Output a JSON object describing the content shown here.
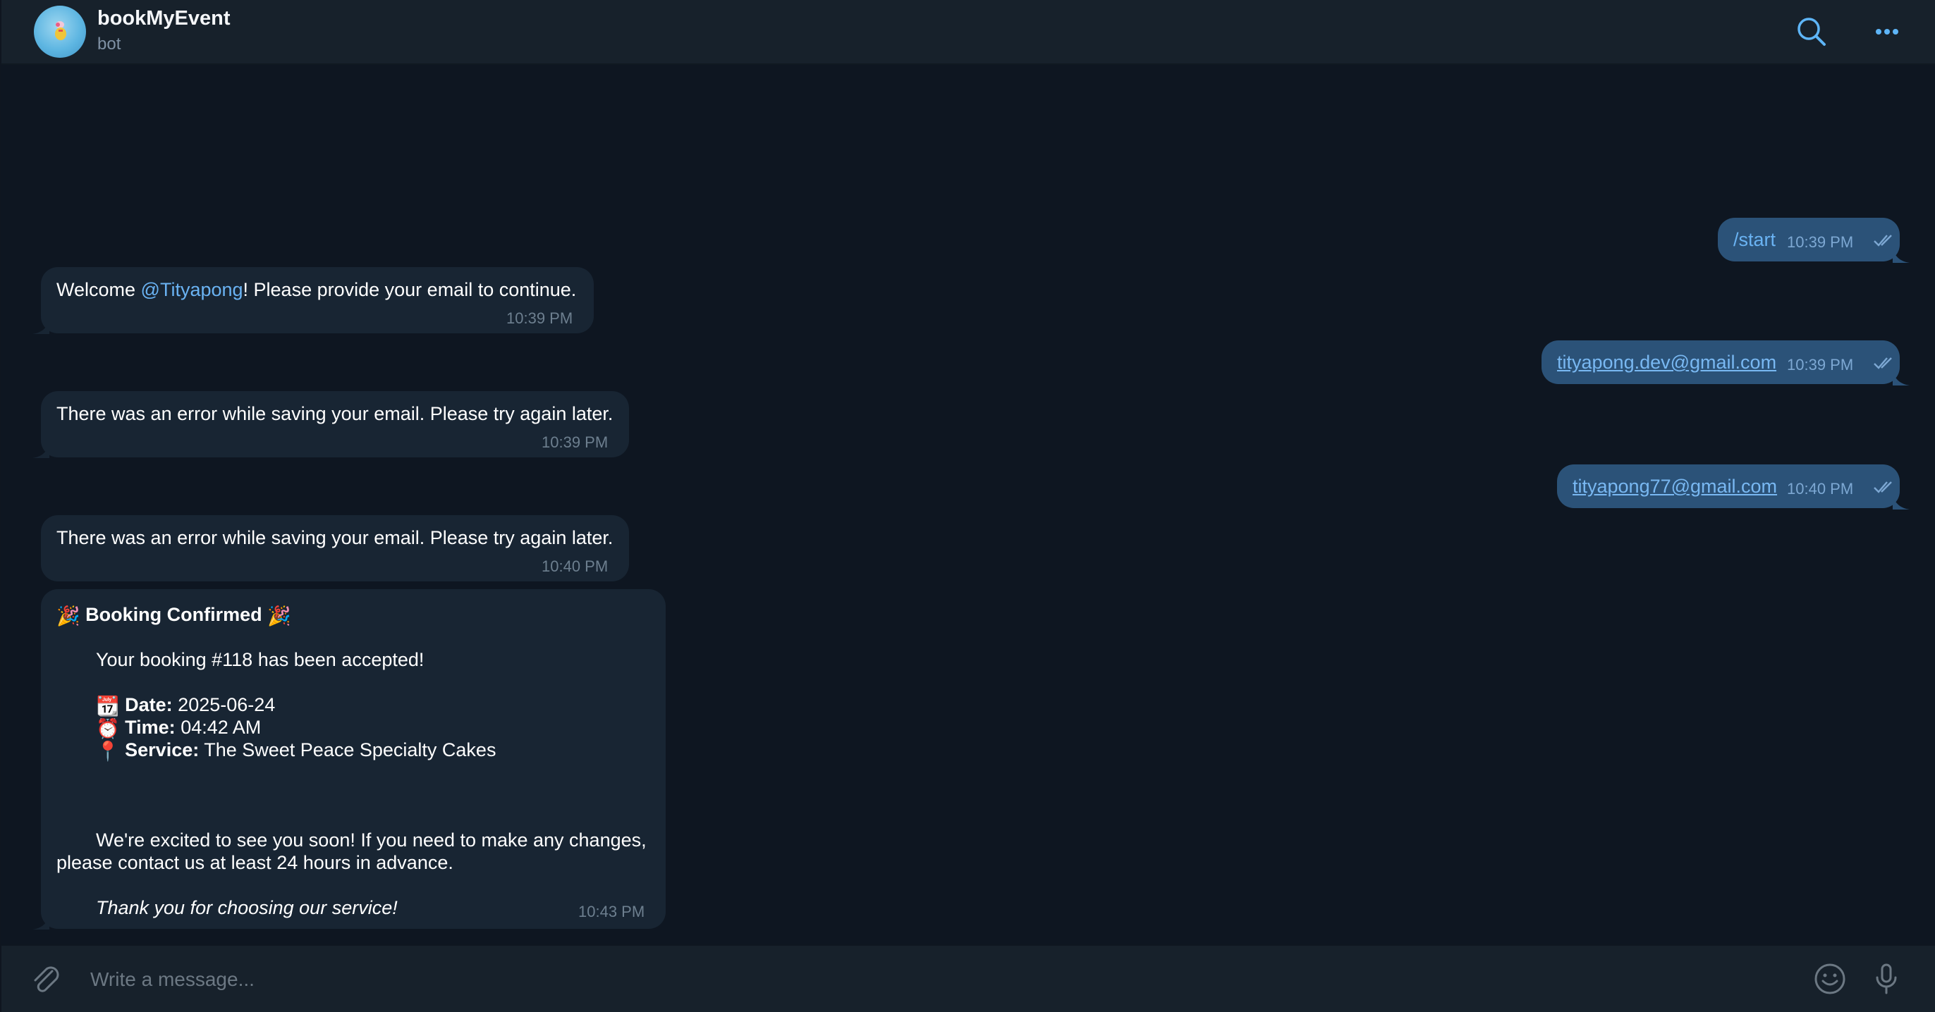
{
  "header": {
    "title": "bookMyEvent",
    "subtitle": "bot",
    "search_icon": "search-icon",
    "more_icon": "more-icon"
  },
  "messages": [
    {
      "direction": "out",
      "text": "/start",
      "time": "10:39 PM",
      "status": "read"
    },
    {
      "direction": "in",
      "text_before": "Welcome ",
      "mention": "@Tityapong",
      "text_after": "! Please provide your email to continue.",
      "time": "10:39 PM"
    },
    {
      "direction": "out",
      "text": "tityapong.dev@gmail.com",
      "time": "10:39 PM",
      "status": "read"
    },
    {
      "direction": "in",
      "text": "There was an error while saving your email. Please try again later.",
      "time": "10:39 PM"
    },
    {
      "direction": "out",
      "text": "tityapong77@gmail.com",
      "time": "10:40 PM",
      "status": "read"
    },
    {
      "direction": "in",
      "text": "There was an error while saving your email. Please try again later.",
      "time": "10:40 PM"
    }
  ],
  "booking": {
    "title_emoji": "🎉",
    "title": "Booking Confirmed",
    "accepted": "Your booking #118 has been accepted!",
    "date_label": "Date:",
    "date_value": "2025-06-24",
    "time_label": "Time:",
    "time_value": "04:42 AM",
    "service_label": "Service:",
    "service_value": "The Sweet Peace Specialty Cakes",
    "excited_1": "We're excited to see you soon! If you need to make any changes,",
    "excited_2": "please contact us at least 24 hours in advance.",
    "thanks": "Thank you for choosing our service!",
    "time": "10:43 PM",
    "date_emoji": "📆",
    "time_emoji": "⏰",
    "service_emoji": "📍"
  },
  "composer": {
    "placeholder": "Write a message...",
    "attach_icon": "paperclip-icon",
    "emoji_icon": "smiley-icon",
    "mic_icon": "microphone-icon"
  },
  "colors": {
    "chat_bg": "#0e1621",
    "header_bg": "#17212b",
    "incoming_bubble": "#182533",
    "outgoing_bubble": "#2b5278",
    "link": "#6ab3f3",
    "accent": "#5eb5f7"
  }
}
